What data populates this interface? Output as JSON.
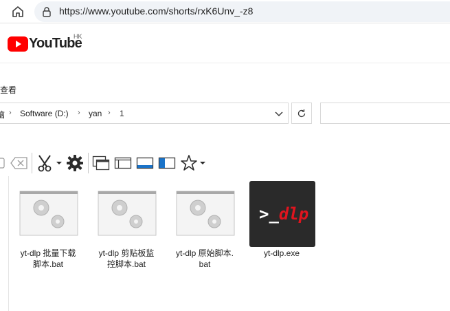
{
  "browser": {
    "url": "https://www.youtube.com/shorts/rxK6Unv_-z8"
  },
  "youtube": {
    "logo_text": "YouTube",
    "region": "HK"
  },
  "explorer": {
    "menu": {
      "view_label": "查看"
    },
    "breadcrumb": {
      "truncated": "脑",
      "drive": "Software (D:)",
      "folder1": "yan",
      "folder2": "1"
    },
    "files": [
      {
        "name": "yt-dlp 批量下载脚本.bat",
        "line1": "yt-dlp 批量下载",
        "line2": "脚本.bat",
        "type": "bat"
      },
      {
        "name": "yt-dlp 剪贴板监控脚本.bat",
        "line1": "yt-dlp 剪贴板监",
        "line2": "控脚本.bat",
        "type": "bat"
      },
      {
        "name": "yt-dlp 原始脚本.bat",
        "line1": "yt-dlp 原始脚本.",
        "line2": "bat",
        "type": "bat"
      },
      {
        "name": "yt-dlp.exe",
        "line1": "yt-dlp.exe",
        "line2": "",
        "type": "exe",
        "logo_prompt": ">_",
        "logo_text": "dlp"
      }
    ]
  },
  "colors": {
    "yt_red": "#ff0000",
    "exe_bg": "#2a2a2a",
    "exe_accent": "#e0141e",
    "icon_blue": "#1a73c8"
  },
  "icons": [
    "home-icon",
    "lock-icon",
    "youtube-play-icon",
    "chevron-right-icon",
    "chevron-down-icon",
    "refresh-icon",
    "scissors-icon",
    "gear-icon",
    "star-icon"
  ]
}
